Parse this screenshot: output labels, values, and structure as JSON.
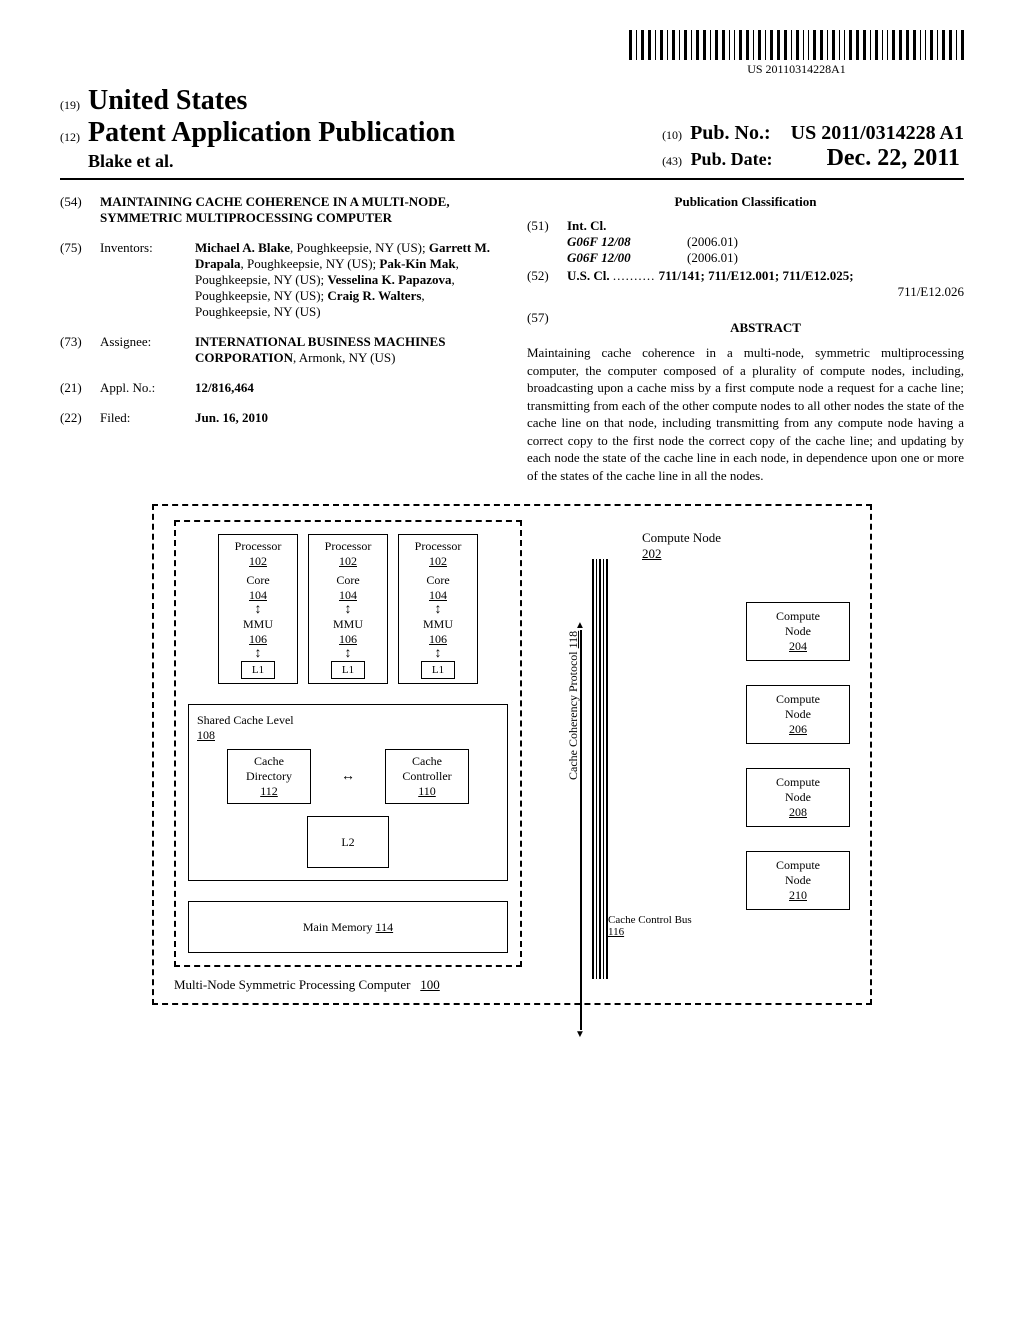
{
  "barcode_text": "US 20110314228A1",
  "header": {
    "code19": "(19)",
    "country": "United States",
    "code12": "(12)",
    "pub_type": "Patent Application Publication",
    "authors": "Blake et al.",
    "code10": "(10)",
    "pub_no_label": "Pub. No.:",
    "pub_no": "US 2011/0314228 A1",
    "code43": "(43)",
    "pub_date_label": "Pub. Date:",
    "pub_date": "Dec. 22, 2011"
  },
  "fields": {
    "title": {
      "code": "(54)",
      "value": "MAINTAINING CACHE COHERENCE IN A MULTI-NODE, SYMMETRIC MULTIPROCESSING COMPUTER"
    },
    "inventors": {
      "code": "(75)",
      "label": "Inventors:",
      "value_html": "Michael A. Blake|, Poughkeepsie, NY (US); |Garrett M. Drapala|, Poughkeepsie, NY (US); |Pak-Kin Mak|, Poughkeepsie, NY (US); |Vesselina K. Papazova|, Poughkeepsie, NY (US); |Craig R. Walters|, Poughkeepsie, NY (US)"
    },
    "assignee": {
      "code": "(73)",
      "label": "Assignee:",
      "name": "INTERNATIONAL BUSINESS MACHINES CORPORATION",
      "loc": "Armonk, NY (US)"
    },
    "appl_no": {
      "code": "(21)",
      "label": "Appl. No.:",
      "value": "12/816,464"
    },
    "filed": {
      "code": "(22)",
      "label": "Filed:",
      "value": "Jun. 16, 2010"
    }
  },
  "classification": {
    "header": "Publication Classification",
    "int_cl": {
      "code": "(51)",
      "label": "Int. Cl.",
      "rows": [
        {
          "class": "G06F 12/08",
          "year": "(2006.01)"
        },
        {
          "class": "G06F 12/00",
          "year": "(2006.01)"
        }
      ]
    },
    "us_cl": {
      "code": "(52)",
      "label": "U.S. Cl.",
      "leader": "..........",
      "value": "711/141; 711/E12.001; 711/E12.025;",
      "extra": "711/E12.026"
    }
  },
  "abstract": {
    "code": "(57)",
    "header": "ABSTRACT",
    "text": "Maintaining cache coherence in a multi-node, symmetric multiprocessing computer, the computer composed of a plurality of compute nodes, including, broadcasting upon a cache miss by a first compute node a request for a cache line; transmitting from each of the other compute nodes to all other nodes the state of the cache line on that node, including transmitting from any compute node having a correct copy to the first node the correct copy of the cache line; and updating by each node the state of the cache line in each node, in dependence upon one or more of the states of the cache line in all the nodes."
  },
  "figure": {
    "processor": "Processor",
    "proc_ref": "102",
    "core": "Core",
    "core_ref": "104",
    "mmu": "MMU",
    "mmu_ref": "106",
    "l1": "L1",
    "shared_cache": "Shared Cache Level",
    "shared_cache_ref": "108",
    "cache_dir": "Cache Directory",
    "cache_dir_ref": "112",
    "cache_ctrl": "Cache Controller",
    "cache_ctrl_ref": "110",
    "l2": "L2",
    "main_mem": "Main Memory",
    "main_mem_ref": "114",
    "compute_node": "Compute Node",
    "node_202": "202",
    "node_204": "204",
    "node_206": "206",
    "node_208": "208",
    "node_210": "210",
    "protocol": "Cache Coherency Protocol",
    "protocol_ref": "118",
    "bus": "Cache Control Bus",
    "bus_ref": "116",
    "footer": "Multi-Node Symmetric Processing Computer",
    "footer_ref": "100"
  }
}
